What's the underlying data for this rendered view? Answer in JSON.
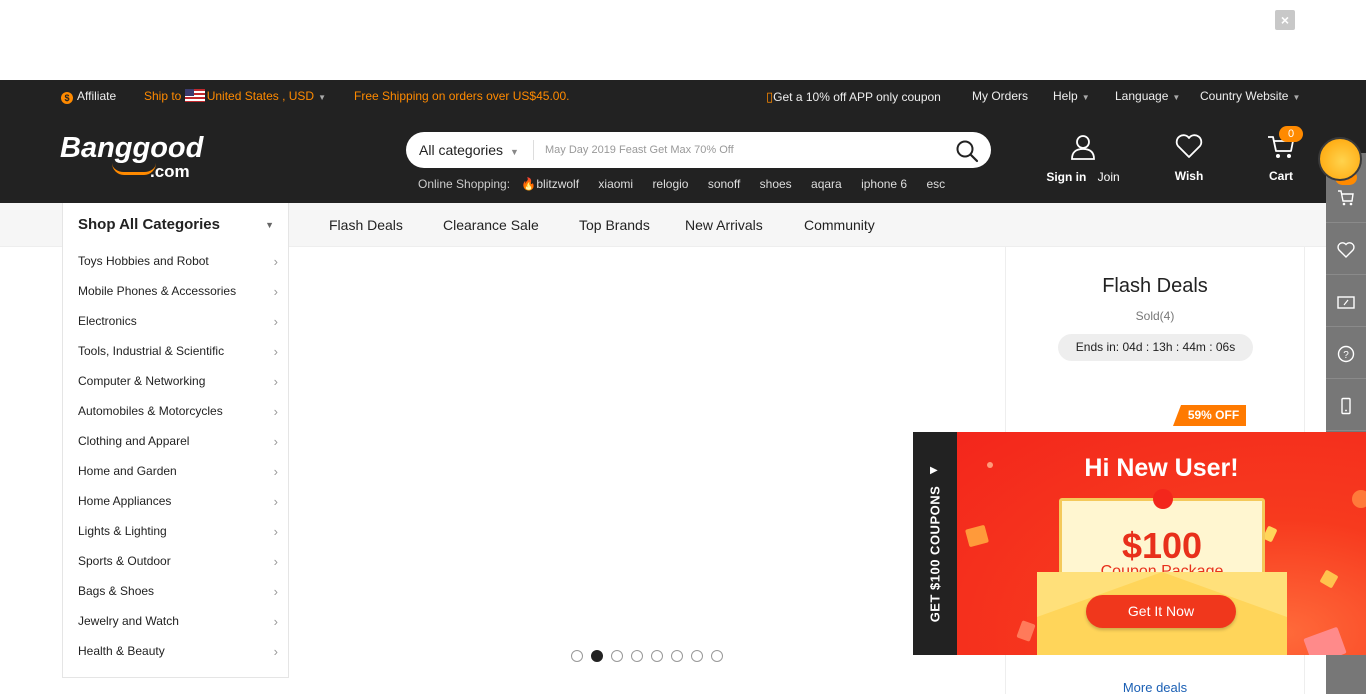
{
  "banner": {
    "close_label": "×"
  },
  "topbar": {
    "affiliate": "Affiliate",
    "ship_to": "Ship to",
    "ship_country": "United States , USD",
    "free_shipping": "Free Shipping on orders over US$45.00.",
    "app_coupon": "Get a 10% off APP only coupon",
    "my_orders": "My Orders",
    "help": "Help",
    "language": "Language",
    "country_website": "Country Website"
  },
  "header": {
    "logo_main": "Banggood",
    "logo_sub": ".com",
    "search": {
      "category": "All categories",
      "placeholder": "May Day 2019 Feast Get Max 70% Off"
    },
    "hot_label": "Online Shopping:",
    "hot_keywords": [
      "blitzwolf",
      "xiaomi",
      "relogio",
      "sonoff",
      "shoes",
      "aqara",
      "iphone 6",
      "esc"
    ],
    "sign_in": "Sign in",
    "join": "Join",
    "wish": "Wish",
    "cart": "Cart",
    "cart_count": "0"
  },
  "nav": {
    "shop_all": "Shop All Categories",
    "links": [
      "Flash Deals",
      "Clearance Sale",
      "Top Brands",
      "New Arrivals",
      "Community"
    ]
  },
  "categories": [
    "Toys Hobbies and Robot",
    "Mobile Phones & Accessories",
    "Electronics",
    "Tools, Industrial & Scientific",
    "Computer & Networking",
    "Automobiles & Motorcycles",
    "Clothing and Apparel",
    "Home and Garden",
    "Home Appliances",
    "Lights & Lighting",
    "Sports & Outdoor",
    "Bags & Shoes",
    "Jewelry and Watch",
    "Health & Beauty"
  ],
  "carousel": {
    "slide_count": 8,
    "active_index": 1
  },
  "flash_deals": {
    "title": "Flash Deals",
    "sold": "Sold(4)",
    "ends_in": "Ends in: 04d : 13h : 44m : 06s",
    "discount": "59% OFF",
    "more": "More deals"
  },
  "sidebar": {
    "cart_count": "0",
    "icons": [
      "cart-icon",
      "heart-icon",
      "coupon-icon",
      "help-icon",
      "phone-icon"
    ]
  },
  "popup": {
    "tab_label": "GET $100 COUPONS",
    "title": "Hi New User!",
    "amount": "$100",
    "package": "Coupon Package",
    "cta": "Get It Now"
  },
  "colors": {
    "accent": "#ff8a00",
    "dark_bar": "#222222",
    "popup_red": "#f3261c",
    "link_blue": "#1a5fb4"
  }
}
